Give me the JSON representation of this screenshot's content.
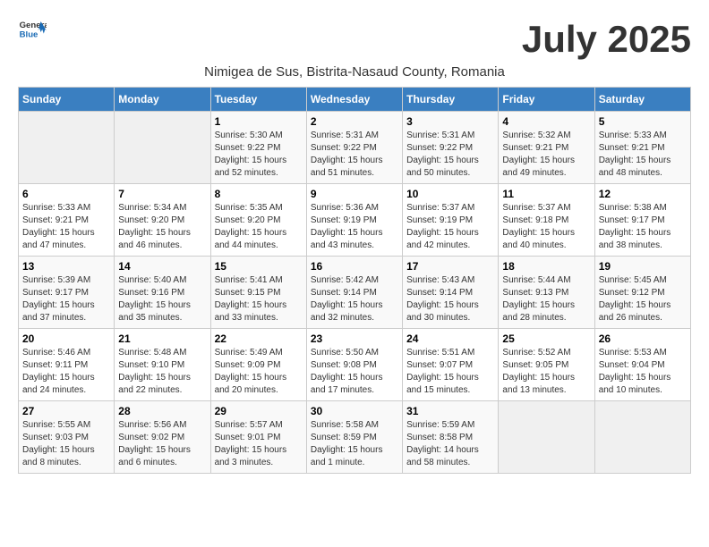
{
  "logo": {
    "general": "General",
    "blue": "Blue"
  },
  "title": "July 2025",
  "subtitle": "Nimigea de Sus, Bistrita-Nasaud County, Romania",
  "days_of_week": [
    "Sunday",
    "Monday",
    "Tuesday",
    "Wednesday",
    "Thursday",
    "Friday",
    "Saturday"
  ],
  "weeks": [
    [
      {
        "day": "",
        "sunrise": "",
        "sunset": "",
        "daylight": ""
      },
      {
        "day": "",
        "sunrise": "",
        "sunset": "",
        "daylight": ""
      },
      {
        "day": "1",
        "sunrise": "Sunrise: 5:30 AM",
        "sunset": "Sunset: 9:22 PM",
        "daylight": "Daylight: 15 hours and 52 minutes."
      },
      {
        "day": "2",
        "sunrise": "Sunrise: 5:31 AM",
        "sunset": "Sunset: 9:22 PM",
        "daylight": "Daylight: 15 hours and 51 minutes."
      },
      {
        "day": "3",
        "sunrise": "Sunrise: 5:31 AM",
        "sunset": "Sunset: 9:22 PM",
        "daylight": "Daylight: 15 hours and 50 minutes."
      },
      {
        "day": "4",
        "sunrise": "Sunrise: 5:32 AM",
        "sunset": "Sunset: 9:21 PM",
        "daylight": "Daylight: 15 hours and 49 minutes."
      },
      {
        "day": "5",
        "sunrise": "Sunrise: 5:33 AM",
        "sunset": "Sunset: 9:21 PM",
        "daylight": "Daylight: 15 hours and 48 minutes."
      }
    ],
    [
      {
        "day": "6",
        "sunrise": "Sunrise: 5:33 AM",
        "sunset": "Sunset: 9:21 PM",
        "daylight": "Daylight: 15 hours and 47 minutes."
      },
      {
        "day": "7",
        "sunrise": "Sunrise: 5:34 AM",
        "sunset": "Sunset: 9:20 PM",
        "daylight": "Daylight: 15 hours and 46 minutes."
      },
      {
        "day": "8",
        "sunrise": "Sunrise: 5:35 AM",
        "sunset": "Sunset: 9:20 PM",
        "daylight": "Daylight: 15 hours and 44 minutes."
      },
      {
        "day": "9",
        "sunrise": "Sunrise: 5:36 AM",
        "sunset": "Sunset: 9:19 PM",
        "daylight": "Daylight: 15 hours and 43 minutes."
      },
      {
        "day": "10",
        "sunrise": "Sunrise: 5:37 AM",
        "sunset": "Sunset: 9:19 PM",
        "daylight": "Daylight: 15 hours and 42 minutes."
      },
      {
        "day": "11",
        "sunrise": "Sunrise: 5:37 AM",
        "sunset": "Sunset: 9:18 PM",
        "daylight": "Daylight: 15 hours and 40 minutes."
      },
      {
        "day": "12",
        "sunrise": "Sunrise: 5:38 AM",
        "sunset": "Sunset: 9:17 PM",
        "daylight": "Daylight: 15 hours and 38 minutes."
      }
    ],
    [
      {
        "day": "13",
        "sunrise": "Sunrise: 5:39 AM",
        "sunset": "Sunset: 9:17 PM",
        "daylight": "Daylight: 15 hours and 37 minutes."
      },
      {
        "day": "14",
        "sunrise": "Sunrise: 5:40 AM",
        "sunset": "Sunset: 9:16 PM",
        "daylight": "Daylight: 15 hours and 35 minutes."
      },
      {
        "day": "15",
        "sunrise": "Sunrise: 5:41 AM",
        "sunset": "Sunset: 9:15 PM",
        "daylight": "Daylight: 15 hours and 33 minutes."
      },
      {
        "day": "16",
        "sunrise": "Sunrise: 5:42 AM",
        "sunset": "Sunset: 9:14 PM",
        "daylight": "Daylight: 15 hours and 32 minutes."
      },
      {
        "day": "17",
        "sunrise": "Sunrise: 5:43 AM",
        "sunset": "Sunset: 9:14 PM",
        "daylight": "Daylight: 15 hours and 30 minutes."
      },
      {
        "day": "18",
        "sunrise": "Sunrise: 5:44 AM",
        "sunset": "Sunset: 9:13 PM",
        "daylight": "Daylight: 15 hours and 28 minutes."
      },
      {
        "day": "19",
        "sunrise": "Sunrise: 5:45 AM",
        "sunset": "Sunset: 9:12 PM",
        "daylight": "Daylight: 15 hours and 26 minutes."
      }
    ],
    [
      {
        "day": "20",
        "sunrise": "Sunrise: 5:46 AM",
        "sunset": "Sunset: 9:11 PM",
        "daylight": "Daylight: 15 hours and 24 minutes."
      },
      {
        "day": "21",
        "sunrise": "Sunrise: 5:48 AM",
        "sunset": "Sunset: 9:10 PM",
        "daylight": "Daylight: 15 hours and 22 minutes."
      },
      {
        "day": "22",
        "sunrise": "Sunrise: 5:49 AM",
        "sunset": "Sunset: 9:09 PM",
        "daylight": "Daylight: 15 hours and 20 minutes."
      },
      {
        "day": "23",
        "sunrise": "Sunrise: 5:50 AM",
        "sunset": "Sunset: 9:08 PM",
        "daylight": "Daylight: 15 hours and 17 minutes."
      },
      {
        "day": "24",
        "sunrise": "Sunrise: 5:51 AM",
        "sunset": "Sunset: 9:07 PM",
        "daylight": "Daylight: 15 hours and 15 minutes."
      },
      {
        "day": "25",
        "sunrise": "Sunrise: 5:52 AM",
        "sunset": "Sunset: 9:05 PM",
        "daylight": "Daylight: 15 hours and 13 minutes."
      },
      {
        "day": "26",
        "sunrise": "Sunrise: 5:53 AM",
        "sunset": "Sunset: 9:04 PM",
        "daylight": "Daylight: 15 hours and 10 minutes."
      }
    ],
    [
      {
        "day": "27",
        "sunrise": "Sunrise: 5:55 AM",
        "sunset": "Sunset: 9:03 PM",
        "daylight": "Daylight: 15 hours and 8 minutes."
      },
      {
        "day": "28",
        "sunrise": "Sunrise: 5:56 AM",
        "sunset": "Sunset: 9:02 PM",
        "daylight": "Daylight: 15 hours and 6 minutes."
      },
      {
        "day": "29",
        "sunrise": "Sunrise: 5:57 AM",
        "sunset": "Sunset: 9:01 PM",
        "daylight": "Daylight: 15 hours and 3 minutes."
      },
      {
        "day": "30",
        "sunrise": "Sunrise: 5:58 AM",
        "sunset": "Sunset: 8:59 PM",
        "daylight": "Daylight: 15 hours and 1 minute."
      },
      {
        "day": "31",
        "sunrise": "Sunrise: 5:59 AM",
        "sunset": "Sunset: 8:58 PM",
        "daylight": "Daylight: 14 hours and 58 minutes."
      },
      {
        "day": "",
        "sunrise": "",
        "sunset": "",
        "daylight": ""
      },
      {
        "day": "",
        "sunrise": "",
        "sunset": "",
        "daylight": ""
      }
    ]
  ]
}
